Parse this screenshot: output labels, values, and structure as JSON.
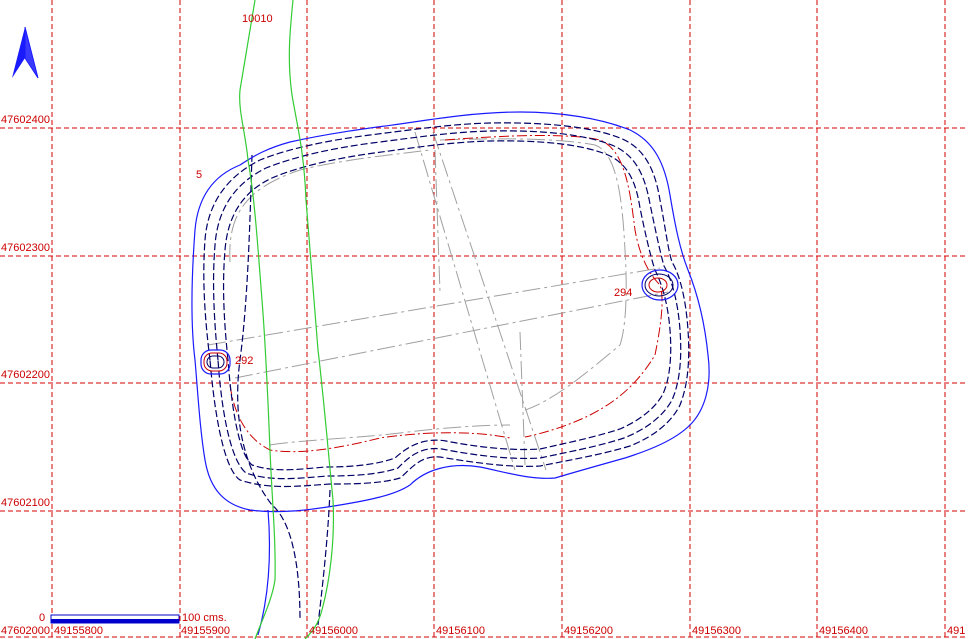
{
  "grid": {
    "x_labels": [
      "49155800",
      "49155900",
      "49156000",
      "49156100",
      "49156200",
      "49156300",
      "49156400",
      "491"
    ],
    "y_labels": [
      "47602000",
      "47602100",
      "47602200",
      "47602300",
      "47602400"
    ]
  },
  "features": {
    "road_label": "10010",
    "small_label": "5",
    "marker_left_label": "292",
    "marker_right_label": "294"
  },
  "scale_bar": {
    "start": "0",
    "end": "100 cms."
  },
  "north_arrow": {
    "icon": "north-arrow-icon"
  },
  "colors": {
    "grid": "#d40000",
    "outer_contour": "#1a1aff",
    "inner_contour": "#000066",
    "red_contour": "#cc0000",
    "road": "#33cc33",
    "gray_lines": "#999999"
  }
}
